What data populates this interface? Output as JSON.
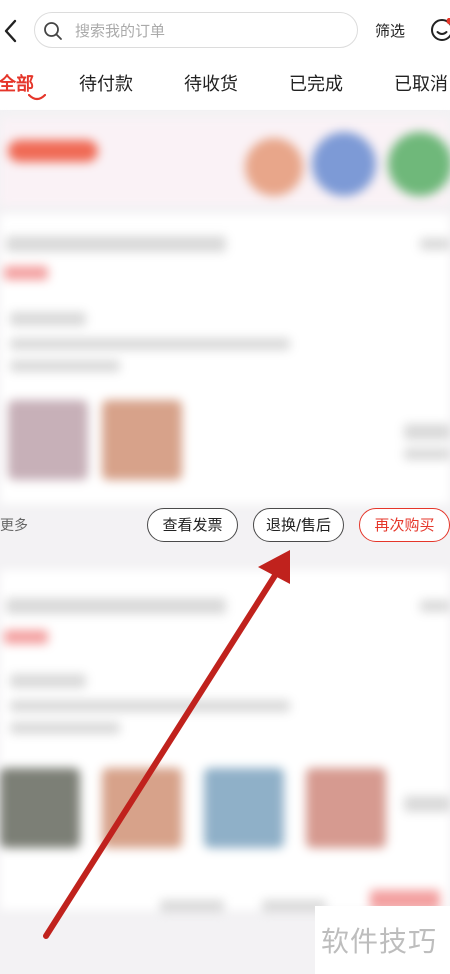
{
  "header": {
    "search_placeholder": "搜索我的订单",
    "filter_label": "筛选"
  },
  "tabs": [
    {
      "label": "全部",
      "active": true
    },
    {
      "label": "待付款"
    },
    {
      "label": "待收货"
    },
    {
      "label": "已完成"
    },
    {
      "label": "已取消"
    }
  ],
  "order": {
    "more_label": "更多",
    "actions": {
      "invoice": "查看发票",
      "return": "退换/售后",
      "rebuy": "再次购买"
    }
  },
  "watermark": "软件技巧",
  "colors": {
    "accent": "#e5362a",
    "arrow": "#c0221d"
  }
}
